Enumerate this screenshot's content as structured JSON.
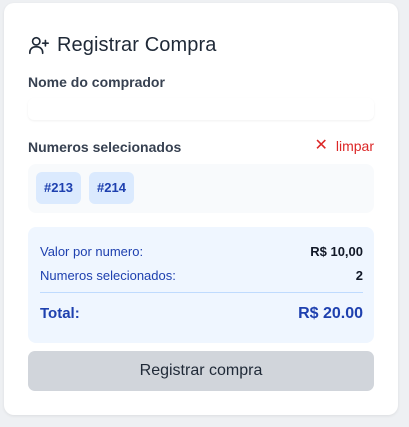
{
  "header": {
    "title": "Registrar Compra",
    "icon": "user-plus-icon"
  },
  "buyer": {
    "label": "Nome do comprador",
    "value": ""
  },
  "selection": {
    "label": "Numeros selecionados",
    "clear_icon": "close-icon",
    "clear_label": "limpar",
    "chips": [
      "#213",
      "#214"
    ]
  },
  "summary": {
    "price_label": "Valor por numero:",
    "price_value": "R$ 10,00",
    "count_label": "Numeros selecionados:",
    "count_value": "2",
    "total_label": "Total:",
    "total_value": "R$ 20.00"
  },
  "submit": {
    "label": "Registrar compra",
    "disabled": true
  },
  "colors": {
    "accent": "#1e40af",
    "danger": "#dc2626",
    "chip_bg": "#dbeafe",
    "summary_bg": "#eff6ff",
    "button_disabled_bg": "#d1d5db"
  }
}
